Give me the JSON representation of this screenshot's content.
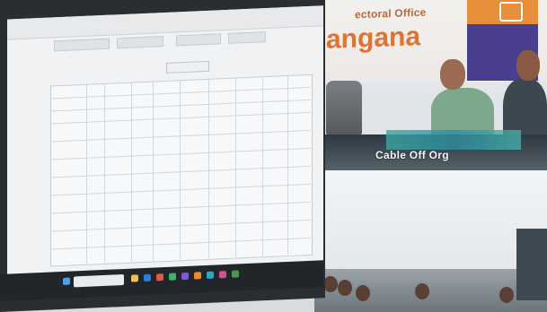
{
  "banner": {
    "top_text": "ectoral Office",
    "main_text": "angana"
  },
  "room": {
    "caption": "Cable Off Org"
  },
  "colors": {
    "banner_orange": "#e0732d",
    "banner_purple": "#4a3f8f",
    "monitor_bezel": "#2a2d31",
    "screen_bg": "#f1f2f4"
  },
  "icons": [
    "windows-start-icon",
    "search-icon",
    "taskbar-app-icons"
  ]
}
